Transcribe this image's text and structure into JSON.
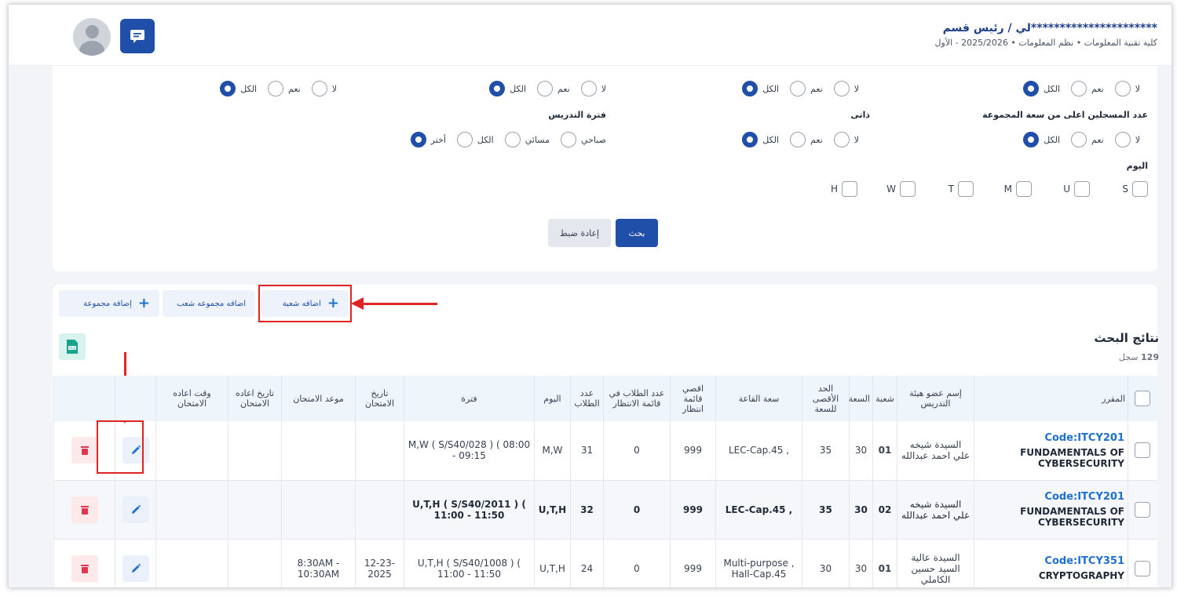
{
  "header": {
    "user_name": "**********************لي / رئيس قسم",
    "college": "كلية تقنية المعلومات",
    "department": "نظم المعلومات",
    "term": "2025/2026 - الأول"
  },
  "filters": {
    "opt_all": "الكل",
    "opt_yes": "نعم",
    "opt_no": "لا",
    "label_over_capacity": "عدد المسجلين اعلى من سعة المجموعة",
    "label_self": "ذاتى",
    "label_period": "فترة التدريس",
    "period_choose": "أختر",
    "period_all": "الكل",
    "period_evening": "مسائي",
    "period_morning": "صباحي",
    "label_day": "اليوم",
    "days": [
      "S",
      "U",
      "M",
      "T",
      "W",
      "H"
    ],
    "search_button": "بحث",
    "reset_button": "إعادة ضبط"
  },
  "actions": {
    "add_group": "إضافة مجموعة",
    "add_section_group": "اضافه مجموعه شعب",
    "add_section": "اضافه شعبة"
  },
  "results": {
    "title": "نتائج البحث",
    "count": "129",
    "count_unit": "سجل",
    "headers": {
      "course": "المقرر",
      "instructor": "إسم عضو هيئة التدريس",
      "section": "شعبة",
      "capacity": "السعة",
      "max_capacity": "الحد الأقصى للسعة",
      "room_capacity": "سعة القاعة",
      "max_waitlist": "اقصي قائمة انتظار",
      "waitlist_students": "عدد الطلاب في قائمة الانتظار",
      "students": "عدد الطلاب",
      "day": "اليوم",
      "period": "فترة",
      "exam_date": "تاريخ الامتحان",
      "exam_time": "موعد الامتحان",
      "reexam_date": "تاريخ اعاده الامتحان",
      "reexam_time": "وقت اعاده الامتحان"
    },
    "rows": [
      {
        "code": "Code:ITCY201",
        "name": "FUNDAMENTALS OF CYBERSECURITY",
        "instructor": "السيدة شيخه علي احمد عبدالله",
        "section": "01",
        "capacity": "30",
        "max_capacity": "35",
        "room": ", LEC-Cap.45",
        "max_waitlist": "999",
        "waitlist": "0",
        "students": "31",
        "day": "M,W",
        "period": "M,W ( S/S40/028 ) ( 08:00 - 09:15",
        "exam_date": "",
        "exam_time": "",
        "reexam_date": "",
        "reexam_time": ""
      },
      {
        "code": "Code:ITCY201",
        "name": "FUNDAMENTALS OF CYBERSECURITY",
        "instructor": "السيدة شيخه علي احمد عبدالله",
        "section": "02",
        "capacity": "30",
        "max_capacity": "35",
        "room": ", LEC-Cap.45",
        "max_waitlist": "999",
        "waitlist": "0",
        "students": "32",
        "day": "U,T,H",
        "period": "U,T,H ( S/S40/2011 ) ( 11:00 - 11:50",
        "exam_date": "",
        "exam_time": "",
        "reexam_date": "",
        "reexam_time": ""
      },
      {
        "code": "Code:ITCY351",
        "name": "CRYPTOGRAPHY",
        "instructor": "السيدة عالية السيد حسين الكاملي",
        "section": "01",
        "capacity": "30",
        "max_capacity": "30",
        "room": "Multi-purpose , Hall-Cap.45",
        "max_waitlist": "999",
        "waitlist": "0",
        "students": "24",
        "day": "U,T,H",
        "period": "U,T,H ( S/S40/1008 ) ( 11:00 - 11:50",
        "exam_date": "12-23-2025",
        "exam_time": "8:30AM - 10:30AM",
        "reexam_date": "",
        "reexam_time": ""
      }
    ]
  },
  "colors": {
    "primary": "#1f4fa8",
    "accent_link": "#1f6fd1",
    "annotation_red": "#e02424",
    "delete_tint": "#fde8ea"
  }
}
